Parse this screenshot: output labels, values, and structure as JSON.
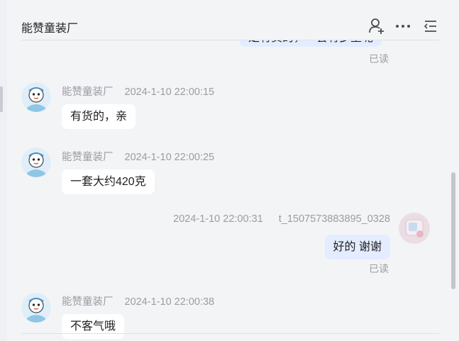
{
  "header": {
    "title": "能赞童装厂",
    "icons": [
      "add-contact-icon",
      "more-icon",
      "list-menu-icon"
    ]
  },
  "messages": {
    "partial_top": {
      "text": "是有货的，一套有多重呢",
      "read": "已读"
    },
    "m1": {
      "sender": "能赞童装厂",
      "time": "2024-1-10 22:00:15",
      "text": "有货的，亲"
    },
    "m2": {
      "sender": "能赞童装厂",
      "time": "2024-1-10 22:00:25",
      "text": "一套大约420克"
    },
    "m3": {
      "sender": "t_1507573883895_0328",
      "time": "2024-1-10 22:00:31",
      "text": "好的 谢谢",
      "read": "已读"
    },
    "m4": {
      "sender": "能赞童装厂",
      "time": "2024-1-10 22:00:38",
      "text": "不客气哦"
    }
  },
  "colors": {
    "background": "#f3f4f6",
    "bubble_incoming": "#ffffff",
    "bubble_outgoing": "#e4ecff",
    "meta_text": "#9a9da3"
  }
}
